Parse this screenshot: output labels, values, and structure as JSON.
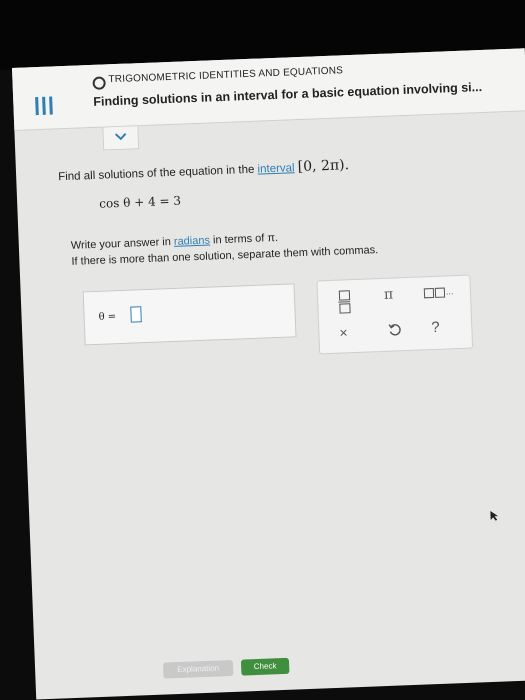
{
  "header": {
    "topic": "TRIGONOMETRIC IDENTITIES AND EQUATIONS",
    "title": "Finding solutions in an interval for a basic equation involving si..."
  },
  "problem": {
    "prompt_prefix": "Find all solutions of the equation in the",
    "interval_link": "interval",
    "interval_value": "[0, 2π).",
    "equation": "cos θ + 4 = 3",
    "instruction_prefix": "Write your answer in",
    "radians_link": "radians",
    "instruction_suffix": "in terms of π.",
    "instruction_line2": "If there is more than one solution, separate them with commas."
  },
  "answer": {
    "label": "θ =",
    "value": ""
  },
  "keypad": {
    "pi": "π",
    "list": "...",
    "clear": "×",
    "help": "?"
  },
  "buttons": {
    "explanation": "Explanation",
    "check": "Check"
  },
  "icons": [
    "menu-icon",
    "chevron-down-icon",
    "fraction-icon",
    "list-icon",
    "undo-icon",
    "pointer-icon"
  ],
  "colors": {
    "accent": "#2f7fb4",
    "check": "#3f8f3f"
  }
}
